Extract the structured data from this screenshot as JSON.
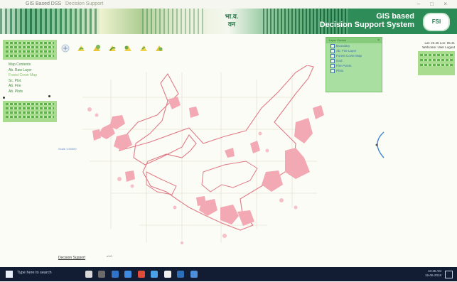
{
  "browser": {
    "tab_title": "GIS Based DSS",
    "tab2_title": "Decision Support",
    "window_controls": "– □ ×"
  },
  "header": {
    "title_line1": "GIS based",
    "title_line2": "Decision Support System",
    "emblem_text": "भा.व.\nवन",
    "logo_text": "FSI"
  },
  "left_panel": {
    "menu": [
      {
        "label": "Map Contents"
      },
      {
        "label": "Ab. Raw Layer"
      },
      {
        "label": "Forest Cover Map"
      },
      {
        "label": "Sc. Plot"
      },
      {
        "label": "Ab. Fire"
      },
      {
        "label": "Ab. Plots"
      }
    ],
    "scale_label": "Scale 1:50000"
  },
  "toolbar": {
    "icons": [
      "zoom-in-icon",
      "zoom-out-icon",
      "pan-icon",
      "identify-icon",
      "measure-icon",
      "full-extent-icon",
      "print-icon"
    ]
  },
  "map": {
    "colors": {
      "boundary": "#e07a86",
      "forest_fill": "#f2a9b4",
      "grid": "#e8e4d4"
    }
  },
  "layer_panel": {
    "title": "Layer Control",
    "items": [
      {
        "label": "Boundary"
      },
      {
        "label": "Ab. Fire Layer"
      },
      {
        "label": "Forest Cover Map"
      },
      {
        "label": "Grid"
      },
      {
        "label": "Fire Points"
      },
      {
        "label": "Plots"
      }
    ]
  },
  "right_panel": {
    "line1": "Lat: 23.45 Lon: 85.31",
    "line2": "Welcome: User Logout"
  },
  "bottom": {
    "note": "Decision Support",
    "note2": "v1.0"
  },
  "taskbar": {
    "search_placeholder": "Type here to search",
    "time": "10:45 AM",
    "date": "15-06-2018"
  }
}
